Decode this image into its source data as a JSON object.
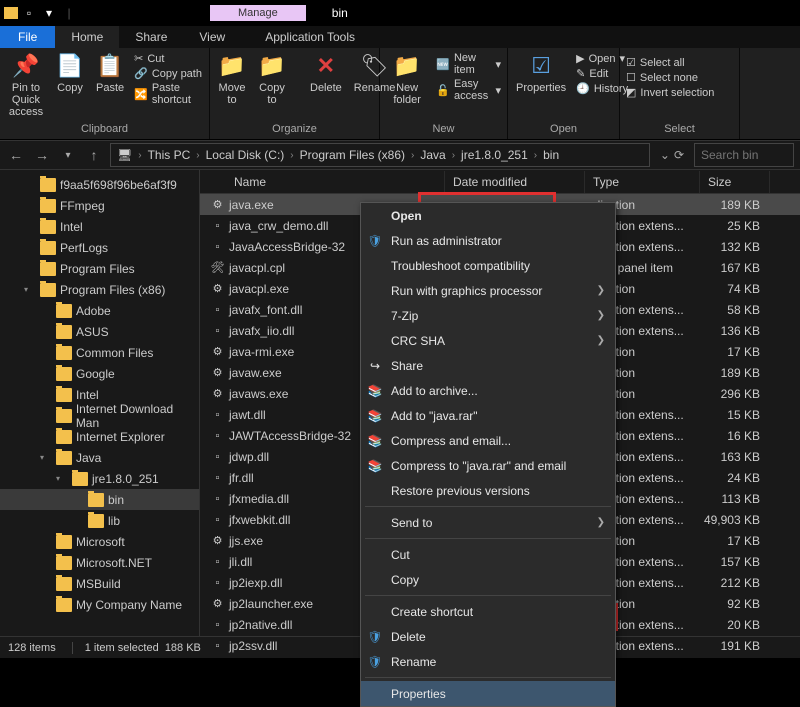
{
  "titlebar": {
    "manage": "Manage",
    "title": "bin"
  },
  "tabs": {
    "file": "File",
    "home": "Home",
    "share": "Share",
    "view": "View",
    "apptools": "Application Tools"
  },
  "ribbon": {
    "pin": "Pin to Quick access",
    "copy": "Copy",
    "paste": "Paste",
    "cut": "Cut",
    "copypath": "Copy path",
    "pasteshortcut": "Paste shortcut",
    "moveto": "Move to",
    "copyto": "Copy to",
    "delete": "Delete",
    "rename": "Rename",
    "newfolder": "New folder",
    "newitem": "New item",
    "easyaccess": "Easy access",
    "properties": "Properties",
    "open": "Open",
    "edit": "Edit",
    "history": "History",
    "selectall": "Select all",
    "selectnone": "Select none",
    "invert": "Invert selection",
    "g_clipboard": "Clipboard",
    "g_organize": "Organize",
    "g_new": "New",
    "g_open": "Open",
    "g_select": "Select"
  },
  "breadcrumb": {
    "items": [
      "This PC",
      "Local Disk (C:)",
      "Program Files (x86)",
      "Java",
      "jre1.8.0_251",
      "bin"
    ]
  },
  "search": {
    "placeholder": "Search bin"
  },
  "treeitems": [
    {
      "label": "f9aa5f698f96be6af3f9",
      "depth": 1
    },
    {
      "label": "FFmpeg",
      "depth": 1
    },
    {
      "label": "Intel",
      "depth": 1
    },
    {
      "label": "PerfLogs",
      "depth": 1
    },
    {
      "label": "Program Files",
      "depth": 1
    },
    {
      "label": "Program Files (x86)",
      "depth": 1,
      "exp": true
    },
    {
      "label": "Adobe",
      "depth": 2
    },
    {
      "label": "ASUS",
      "depth": 2
    },
    {
      "label": "Common Files",
      "depth": 2
    },
    {
      "label": "Google",
      "depth": 2
    },
    {
      "label": "Intel",
      "depth": 2
    },
    {
      "label": "Internet Download Man",
      "depth": 2
    },
    {
      "label": "Internet Explorer",
      "depth": 2
    },
    {
      "label": "Java",
      "depth": 2,
      "exp": true
    },
    {
      "label": "jre1.8.0_251",
      "depth": 3,
      "exp": true
    },
    {
      "label": "bin",
      "depth": 4,
      "sel": true
    },
    {
      "label": "lib",
      "depth": 4
    },
    {
      "label": "Microsoft",
      "depth": 2
    },
    {
      "label": "Microsoft.NET",
      "depth": 2
    },
    {
      "label": "MSBuild",
      "depth": 2
    },
    {
      "label": "My Company Name",
      "depth": 2
    }
  ],
  "columns": {
    "name": "Name",
    "modified": "Date modified",
    "type": "Type",
    "size": "Size"
  },
  "files": [
    {
      "name": "java.exe",
      "icon": "app",
      "type": "plication",
      "size": "189 KB",
      "sel": true
    },
    {
      "name": "java_crw_demo.dll",
      "icon": "dll",
      "type": "plication extens...",
      "size": "25 KB"
    },
    {
      "name": "JavaAccessBridge-32",
      "icon": "dll",
      "type": "plication extens...",
      "size": "132 KB"
    },
    {
      "name": "javacpl.cpl",
      "icon": "cpl",
      "type": "ntrol panel item",
      "size": "167 KB"
    },
    {
      "name": "javacpl.exe",
      "icon": "app",
      "type": "plication",
      "size": "74 KB"
    },
    {
      "name": "javafx_font.dll",
      "icon": "dll",
      "type": "plication extens...",
      "size": "58 KB"
    },
    {
      "name": "javafx_iio.dll",
      "icon": "dll",
      "type": "plication extens...",
      "size": "136 KB"
    },
    {
      "name": "java-rmi.exe",
      "icon": "app",
      "type": "plication",
      "size": "17 KB"
    },
    {
      "name": "javaw.exe",
      "icon": "app",
      "type": "plication",
      "size": "189 KB"
    },
    {
      "name": "javaws.exe",
      "icon": "app",
      "type": "plication",
      "size": "296 KB"
    },
    {
      "name": "jawt.dll",
      "icon": "dll",
      "type": "plication extens...",
      "size": "15 KB"
    },
    {
      "name": "JAWTAccessBridge-32",
      "icon": "dll",
      "type": "plication extens...",
      "size": "16 KB"
    },
    {
      "name": "jdwp.dll",
      "icon": "dll",
      "type": "plication extens...",
      "size": "163 KB"
    },
    {
      "name": "jfr.dll",
      "icon": "dll",
      "type": "plication extens...",
      "size": "24 KB"
    },
    {
      "name": "jfxmedia.dll",
      "icon": "dll",
      "type": "plication extens...",
      "size": "113 KB"
    },
    {
      "name": "jfxwebkit.dll",
      "icon": "dll",
      "type": "plication extens...",
      "size": "49,903 KB"
    },
    {
      "name": "jjs.exe",
      "icon": "app",
      "type": "plication",
      "size": "17 KB"
    },
    {
      "name": "jli.dll",
      "icon": "dll",
      "type": "plication extens...",
      "size": "157 KB"
    },
    {
      "name": "jp2iexp.dll",
      "icon": "dll",
      "type": "plication extens...",
      "size": "212 KB"
    },
    {
      "name": "jp2launcher.exe",
      "icon": "app",
      "type": "plication",
      "size": "92 KB"
    },
    {
      "name": "jp2native.dll",
      "icon": "dll",
      "type": "plication extens...",
      "size": "20 KB"
    },
    {
      "name": "jp2ssv.dll",
      "icon": "dll",
      "type": "plication extens...",
      "size": "191 KB"
    }
  ],
  "context": {
    "open": "Open",
    "runas": "Run as administrator",
    "troubleshoot": "Troubleshoot compatibility",
    "graphics": "Run with graphics processor",
    "sevenzip": "7-Zip",
    "crcsha": "CRC SHA",
    "share": "Share",
    "addarchive": "Add to archive...",
    "addrar": "Add to \"java.rar\"",
    "compressemail": "Compress and email...",
    "compressrar": "Compress to \"java.rar\" and email",
    "restore": "Restore previous versions",
    "sendto": "Send to",
    "cut": "Cut",
    "copy": "Copy",
    "shortcut": "Create shortcut",
    "delete": "Delete",
    "rename": "Rename",
    "properties": "Properties"
  },
  "status": {
    "count": "128 items",
    "selected": "1 item selected",
    "size": "188 KB"
  }
}
